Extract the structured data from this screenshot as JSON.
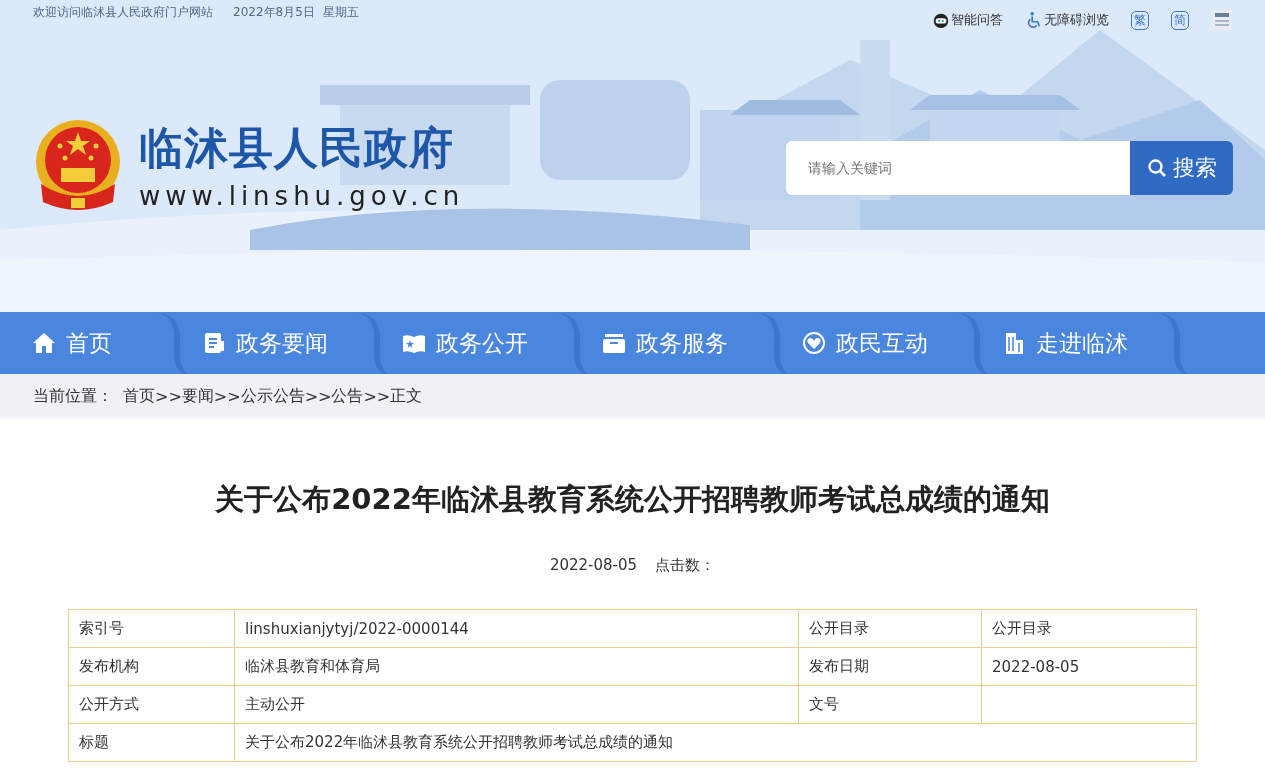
{
  "top_bar": {
    "welcome": "欢迎访问临沭县人民政府门户网站",
    "date": "2022年8月5日",
    "weekday": "星期五",
    "links": [
      {
        "label": "智能问答",
        "kind": "robot"
      },
      {
        "label": "无障碍浏览",
        "kind": "access"
      },
      {
        "label": "繁",
        "kind": "boxed"
      },
      {
        "label": "简",
        "kind": "boxed"
      },
      {
        "kind": "service"
      }
    ]
  },
  "header": {
    "site_name": "临沭县人民政府",
    "domain": "www.linshu.gov.cn",
    "search": {
      "placeholder": "请输入关键词",
      "button": "搜索"
    }
  },
  "nav": [
    {
      "label": "首页"
    },
    {
      "label": "政务要闻"
    },
    {
      "label": "政务公开"
    },
    {
      "label": "政务服务"
    },
    {
      "label": "政民互动"
    },
    {
      "label": "走进临沭"
    }
  ],
  "breadcrumb": {
    "label": "当前位置：",
    "separator": ">>",
    "items": [
      "首页",
      "要闻",
      "公示公告",
      "公告",
      "正文"
    ]
  },
  "article": {
    "title": "关于公布2022年临沭县教育系统公开招聘教师考试总成绩的通知",
    "date": "2022-08-05",
    "hits_label": "点击数：",
    "info_table": [
      [
        "索引号",
        "linshuxianjytyj/2022-0000144",
        "公开目录",
        "公开目录"
      ],
      [
        "发布机构",
        "临沭县教育和体育局",
        "发布日期",
        "2022-08-05"
      ],
      [
        "公开方式",
        "主动公开",
        "文号"
      ],
      [
        "标题",
        "关于公布2022年临沭县教育系统公开招聘教师考试总成绩的通知"
      ]
    ]
  }
}
